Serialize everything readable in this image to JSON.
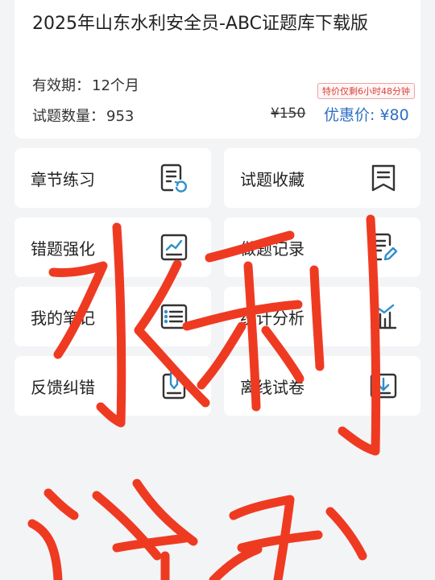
{
  "product": {
    "title": "2025年山东水利安全员-ABC证题库下载版",
    "validity_label": "有效期：",
    "validity_value": "12个月",
    "count_label": "试题数量：",
    "count_value": "953",
    "promo_tag": "特价仅剩6小时48分钟",
    "original_price": "¥150",
    "sale_label": "优惠价:",
    "sale_price": "¥80"
  },
  "tiles": [
    {
      "label": "章节练习",
      "icon": "chapter-practice-icon"
    },
    {
      "label": "试题收藏",
      "icon": "bookmark-icon"
    },
    {
      "label": "错题强化",
      "icon": "trend-chart-icon"
    },
    {
      "label": "做题记录",
      "icon": "record-edit-icon"
    },
    {
      "label": "我的笔记",
      "icon": "notes-list-icon"
    },
    {
      "label": "统计分析",
      "icon": "bar-chart-icon"
    },
    {
      "label": "反馈纠错",
      "icon": "feedback-pen-icon"
    },
    {
      "label": "离线试卷",
      "icon": "download-icon"
    }
  ],
  "colors": {
    "accent_blue": "#2f6fc2",
    "promo_red": "#d6453d",
    "scribble_red": "#ef3a22",
    "icon_stroke": "#333333"
  }
}
